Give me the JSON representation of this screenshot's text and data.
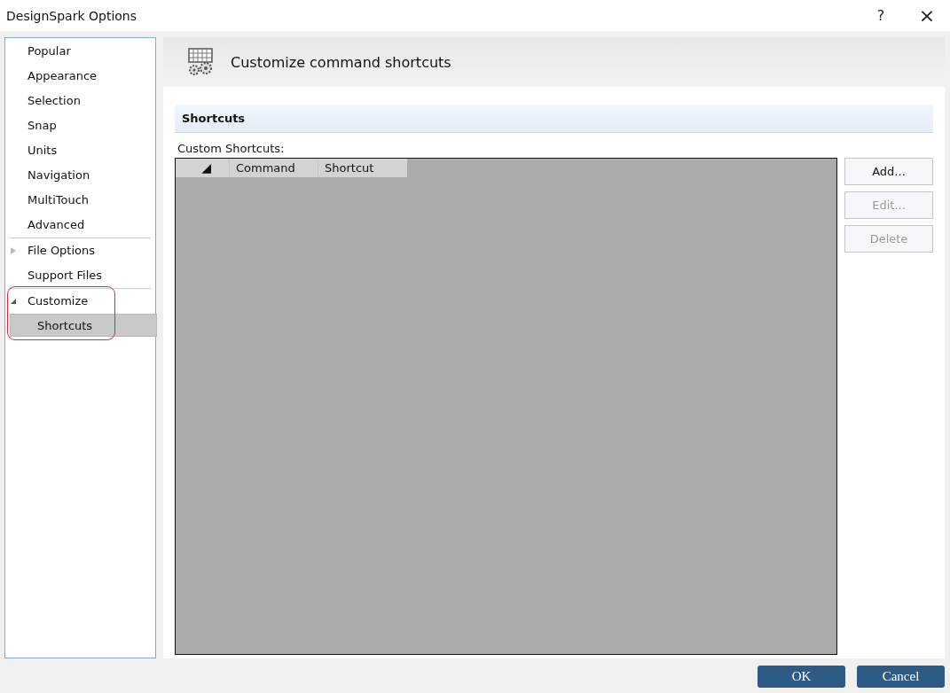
{
  "window": {
    "title": "DesignSpark Options",
    "help": "?",
    "close": "×"
  },
  "sidebar": {
    "groups": [
      {
        "items": [
          {
            "label": "Popular",
            "selected": false
          },
          {
            "label": "Appearance",
            "selected": false
          },
          {
            "label": "Selection",
            "selected": false
          },
          {
            "label": "Snap",
            "selected": false
          },
          {
            "label": "Units",
            "selected": false
          },
          {
            "label": "Navigation",
            "selected": false
          },
          {
            "label": "MultiTouch",
            "selected": false
          },
          {
            "label": "Advanced",
            "selected": false
          }
        ]
      },
      {
        "items": [
          {
            "label": "File Options",
            "selected": false,
            "expanded": false
          },
          {
            "label": "Support Files",
            "selected": false
          }
        ]
      },
      {
        "items": [
          {
            "label": "Customize",
            "selected": false,
            "expanded": true,
            "children": [
              {
                "label": "Shortcuts",
                "selected": true
              }
            ]
          }
        ]
      }
    ]
  },
  "page_header": {
    "title": "Customize command shortcuts"
  },
  "section": {
    "title": "Shortcuts",
    "list_label": "Custom Shortcuts:",
    "table": {
      "columns": [
        "Command",
        "Shortcut"
      ],
      "sort_marker": "◢"
    },
    "buttons": [
      {
        "label": "Add...",
        "disabled": false
      },
      {
        "label": "Edit...",
        "disabled": true
      },
      {
        "label": "Delete",
        "disabled": true
      }
    ]
  },
  "footer_buttons": [
    "OK",
    "Cancel"
  ]
}
